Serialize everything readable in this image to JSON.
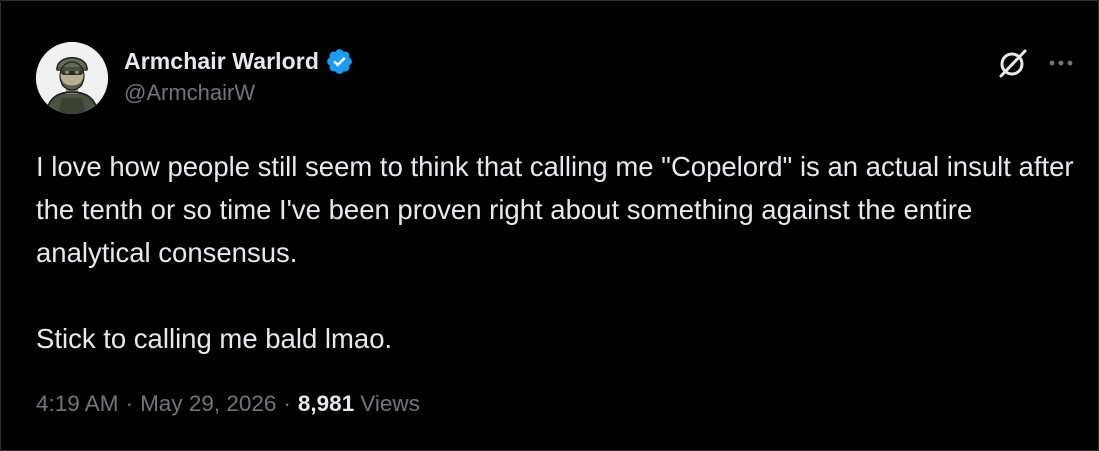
{
  "tweet": {
    "author": {
      "display_name": "Armchair Warlord",
      "handle": "@ArmchairW",
      "verified": true,
      "avatar_icon": "avatar-soldier-illustration"
    },
    "paragraphs": [
      "I love how people still seem to think that calling me \"Copelord\" is an actual insult after the tenth or so time I've been proven right about something against the entire analytical consensus.",
      "Stick to calling me bald lmao."
    ],
    "time": "4:19 AM",
    "date": "May 29, 2026",
    "separator": "·",
    "views_count": "8,981",
    "views_label": "Views",
    "icons": {
      "grok": "grok-icon",
      "more": "more-icon",
      "verified": "verified-badge-icon"
    },
    "colors": {
      "background": "#000000",
      "text": "#e7e9ea",
      "secondary": "#71767b",
      "verified": "#1d9bf0",
      "border": "#2f3336"
    }
  }
}
